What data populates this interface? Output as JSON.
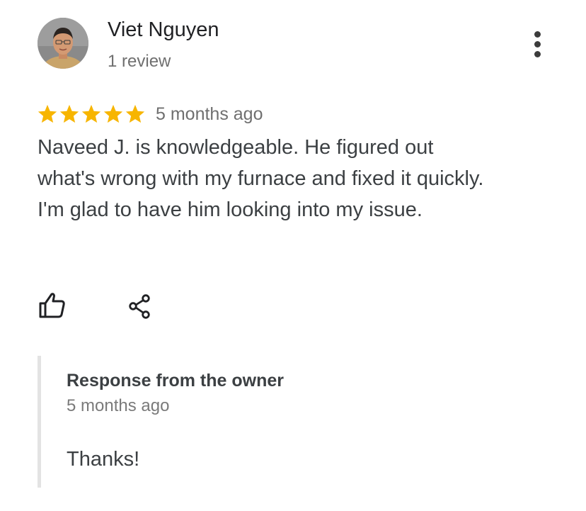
{
  "reviewer": {
    "name": "Viet Nguyen",
    "review_count": "1 review"
  },
  "review": {
    "rating": 5,
    "rating_max": 5,
    "date": "5 months ago",
    "text": "Naveed J. is knowledgeable. He figured out what's wrong with my furnace and fixed it quickly. I'm glad to have him looking into my issue."
  },
  "owner_response": {
    "title": "Response from the owner",
    "date": "5 months ago",
    "text": "Thanks!"
  },
  "colors": {
    "star": "#f7b500",
    "text_primary": "#202124",
    "text_secondary": "#6f6f6f",
    "response_border": "#e3e3e3"
  },
  "icons": {
    "more": "more-vert-icon",
    "like": "thumb-up-icon",
    "share": "share-icon"
  }
}
